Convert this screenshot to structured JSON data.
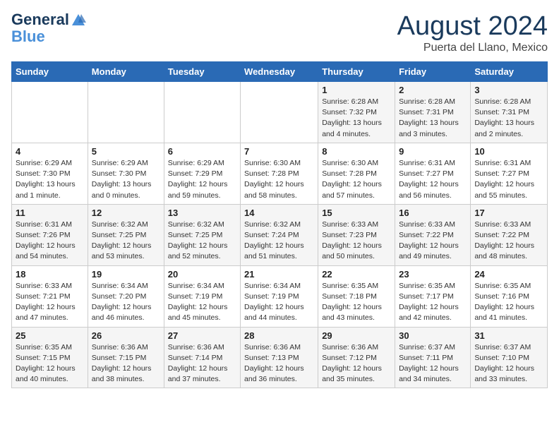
{
  "header": {
    "logo_line1": "General",
    "logo_line2": "Blue",
    "month_year": "August 2024",
    "location": "Puerta del Llano, Mexico"
  },
  "weekdays": [
    "Sunday",
    "Monday",
    "Tuesday",
    "Wednesday",
    "Thursday",
    "Friday",
    "Saturday"
  ],
  "weeks": [
    [
      {
        "day": "",
        "info": ""
      },
      {
        "day": "",
        "info": ""
      },
      {
        "day": "",
        "info": ""
      },
      {
        "day": "",
        "info": ""
      },
      {
        "day": "1",
        "info": "Sunrise: 6:28 AM\nSunset: 7:32 PM\nDaylight: 13 hours\nand 4 minutes."
      },
      {
        "day": "2",
        "info": "Sunrise: 6:28 AM\nSunset: 7:31 PM\nDaylight: 13 hours\nand 3 minutes."
      },
      {
        "day": "3",
        "info": "Sunrise: 6:28 AM\nSunset: 7:31 PM\nDaylight: 13 hours\nand 2 minutes."
      }
    ],
    [
      {
        "day": "4",
        "info": "Sunrise: 6:29 AM\nSunset: 7:30 PM\nDaylight: 13 hours\nand 1 minute."
      },
      {
        "day": "5",
        "info": "Sunrise: 6:29 AM\nSunset: 7:30 PM\nDaylight: 13 hours\nand 0 minutes."
      },
      {
        "day": "6",
        "info": "Sunrise: 6:29 AM\nSunset: 7:29 PM\nDaylight: 12 hours\nand 59 minutes."
      },
      {
        "day": "7",
        "info": "Sunrise: 6:30 AM\nSunset: 7:28 PM\nDaylight: 12 hours\nand 58 minutes."
      },
      {
        "day": "8",
        "info": "Sunrise: 6:30 AM\nSunset: 7:28 PM\nDaylight: 12 hours\nand 57 minutes."
      },
      {
        "day": "9",
        "info": "Sunrise: 6:31 AM\nSunset: 7:27 PM\nDaylight: 12 hours\nand 56 minutes."
      },
      {
        "day": "10",
        "info": "Sunrise: 6:31 AM\nSunset: 7:27 PM\nDaylight: 12 hours\nand 55 minutes."
      }
    ],
    [
      {
        "day": "11",
        "info": "Sunrise: 6:31 AM\nSunset: 7:26 PM\nDaylight: 12 hours\nand 54 minutes."
      },
      {
        "day": "12",
        "info": "Sunrise: 6:32 AM\nSunset: 7:25 PM\nDaylight: 12 hours\nand 53 minutes."
      },
      {
        "day": "13",
        "info": "Sunrise: 6:32 AM\nSunset: 7:25 PM\nDaylight: 12 hours\nand 52 minutes."
      },
      {
        "day": "14",
        "info": "Sunrise: 6:32 AM\nSunset: 7:24 PM\nDaylight: 12 hours\nand 51 minutes."
      },
      {
        "day": "15",
        "info": "Sunrise: 6:33 AM\nSunset: 7:23 PM\nDaylight: 12 hours\nand 50 minutes."
      },
      {
        "day": "16",
        "info": "Sunrise: 6:33 AM\nSunset: 7:22 PM\nDaylight: 12 hours\nand 49 minutes."
      },
      {
        "day": "17",
        "info": "Sunrise: 6:33 AM\nSunset: 7:22 PM\nDaylight: 12 hours\nand 48 minutes."
      }
    ],
    [
      {
        "day": "18",
        "info": "Sunrise: 6:33 AM\nSunset: 7:21 PM\nDaylight: 12 hours\nand 47 minutes."
      },
      {
        "day": "19",
        "info": "Sunrise: 6:34 AM\nSunset: 7:20 PM\nDaylight: 12 hours\nand 46 minutes."
      },
      {
        "day": "20",
        "info": "Sunrise: 6:34 AM\nSunset: 7:19 PM\nDaylight: 12 hours\nand 45 minutes."
      },
      {
        "day": "21",
        "info": "Sunrise: 6:34 AM\nSunset: 7:19 PM\nDaylight: 12 hours\nand 44 minutes."
      },
      {
        "day": "22",
        "info": "Sunrise: 6:35 AM\nSunset: 7:18 PM\nDaylight: 12 hours\nand 43 minutes."
      },
      {
        "day": "23",
        "info": "Sunrise: 6:35 AM\nSunset: 7:17 PM\nDaylight: 12 hours\nand 42 minutes."
      },
      {
        "day": "24",
        "info": "Sunrise: 6:35 AM\nSunset: 7:16 PM\nDaylight: 12 hours\nand 41 minutes."
      }
    ],
    [
      {
        "day": "25",
        "info": "Sunrise: 6:35 AM\nSunset: 7:15 PM\nDaylight: 12 hours\nand 40 minutes."
      },
      {
        "day": "26",
        "info": "Sunrise: 6:36 AM\nSunset: 7:15 PM\nDaylight: 12 hours\nand 38 minutes."
      },
      {
        "day": "27",
        "info": "Sunrise: 6:36 AM\nSunset: 7:14 PM\nDaylight: 12 hours\nand 37 minutes."
      },
      {
        "day": "28",
        "info": "Sunrise: 6:36 AM\nSunset: 7:13 PM\nDaylight: 12 hours\nand 36 minutes."
      },
      {
        "day": "29",
        "info": "Sunrise: 6:36 AM\nSunset: 7:12 PM\nDaylight: 12 hours\nand 35 minutes."
      },
      {
        "day": "30",
        "info": "Sunrise: 6:37 AM\nSunset: 7:11 PM\nDaylight: 12 hours\nand 34 minutes."
      },
      {
        "day": "31",
        "info": "Sunrise: 6:37 AM\nSunset: 7:10 PM\nDaylight: 12 hours\nand 33 minutes."
      }
    ]
  ]
}
